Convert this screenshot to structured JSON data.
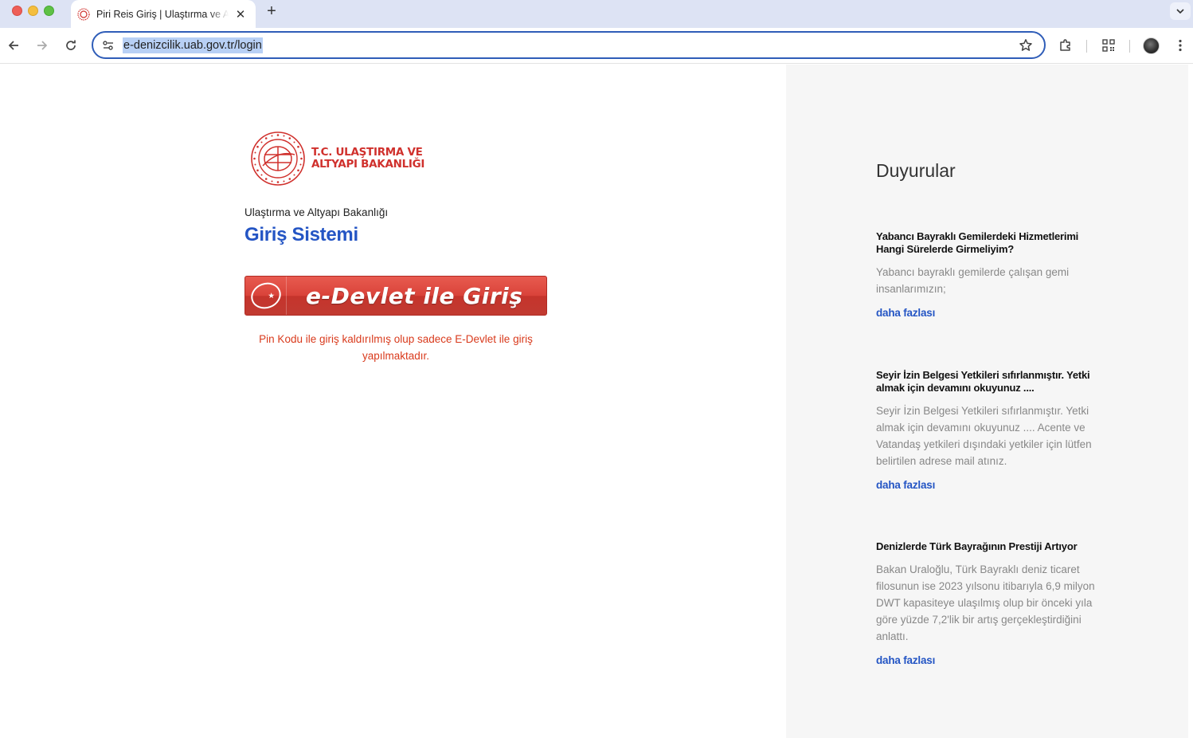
{
  "browser": {
    "tab_title": "Piri Reis Giriş | Ulaştırma ve Altyapı Bakanlığı",
    "new_tab_symbol": "+",
    "close_symbol": "✕",
    "url": "e-denizcilik.uab.gov.tr/login"
  },
  "login": {
    "logo_line1": "T.C. ULAŞTIRMA VE",
    "logo_line2": "ALTYAPI BAKANLIĞI",
    "subtitle": "Ulaştırma ve Altyapı Bakanlığı",
    "title": "Giriş Sistemi",
    "edevlet_button": "e-Devlet ile Giriş",
    "notice": "Pin Kodu ile giriş kaldırılmış olup sadece E-Devlet ile giriş yapılmaktadır.",
    "brand_red": "#d0312d",
    "brand_blue": "#2455c4"
  },
  "announcements": {
    "title": "Duyurular",
    "items": [
      {
        "headline": "Yabancı Bayraklı Gemilerdeki Hizmetlerimi Hangi Sürelerde Girmeliyim?",
        "body": "Yabancı bayraklı gemilerde çalışan gemi insanlarımızın;",
        "more": "daha fazlası"
      },
      {
        "headline": "Seyir İzin Belgesi Yetkileri sıfırlanmıştır. Yetki almak için devamını okuyunuz ....",
        "body": "Seyir İzin Belgesi Yetkileri sıfırlanmıştır. Yetki almak için devamını okuyunuz .... Acente ve Vatandaş yetkileri dışındaki yetkiler için lütfen belirtilen adrese mail atınız.",
        "more": "daha fazlası"
      },
      {
        "headline": "Denizlerde Türk Bayrağının Prestiji Artıyor",
        "body": "Bakan Uraloğlu, Türk Bayraklı deniz ticaret filosunun ise 2023 yılsonu itibarıyla 6,9 milyon DWT kapasiteye ulaşılmış olup bir önceki yıla göre yüzde 7,2'lik bir artış gerçekleştirdiğini anlattı.",
        "more": "daha fazlası"
      }
    ]
  }
}
